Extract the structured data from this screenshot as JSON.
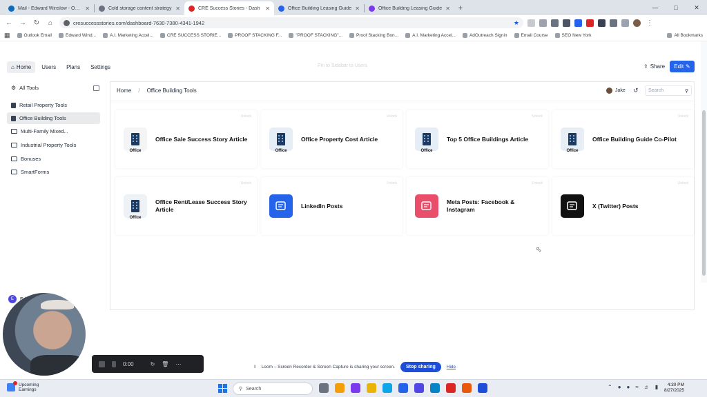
{
  "browser": {
    "tabs": [
      {
        "title": "Mail - Edward Winslow - Outlo",
        "color": "#0f6cbd",
        "active": false
      },
      {
        "title": "Cold storage content strategy",
        "color": "#6b7280",
        "active": false
      },
      {
        "title": "CRE Success Stories - Dash",
        "color": "#dc2626",
        "active": true
      },
      {
        "title": "Office Building Leasing Guide",
        "color": "#2563eb",
        "active": false
      },
      {
        "title": "Office Building Leasing Guide",
        "color": "#7c3aed",
        "active": false
      }
    ],
    "url": "cresuccessstories.com/dashboard-7630-7380-4341-1942",
    "bookmarks": [
      "Outlook Email",
      "Edward Wind...",
      "A.I. Marketing Accel...",
      "CRE SUCCESS STORIE...",
      "PROOF STACKING F...",
      "\"PROOF STACKING\"...",
      "Proof Stacking Bon...",
      "A.I. Marketing Accel...",
      "AdOutreach Signin",
      "Email Course",
      "SEO New York"
    ],
    "all_bookmarks": "All Bookmarks"
  },
  "header": {
    "nav": [
      {
        "label": "Home",
        "active": true
      },
      {
        "label": "Users",
        "active": false
      },
      {
        "label": "Plans",
        "active": false
      },
      {
        "label": "Settings",
        "active": false
      }
    ],
    "center_text": "Pin to Sidebar to Users",
    "share_label": "Share",
    "edit_label": "Edit"
  },
  "sidebar": {
    "all_tools_label": "All Tools",
    "items": [
      {
        "label": "Retail Property Tools",
        "icon": "building-icon",
        "active": false
      },
      {
        "label": "Office Building Tools",
        "icon": "building-icon",
        "active": true
      },
      {
        "label": "Multi-Family Mixed...",
        "icon": "folder-icon",
        "active": false
      },
      {
        "label": "Industrial Property Tools",
        "icon": "folder-icon",
        "active": false
      },
      {
        "label": "Bonuses",
        "icon": "folder-icon",
        "active": false
      },
      {
        "label": "SmartForms",
        "icon": "folder-icon",
        "active": false
      }
    ],
    "profile_name": "Ed...w"
  },
  "main": {
    "breadcrumb": [
      "Home",
      "Office Building Tools"
    ],
    "user_name": "Jake",
    "search_placeholder": "Search",
    "badge_text": "Unlock",
    "cards": [
      {
        "title": "Office Sale Success Story Article",
        "tag": "Office",
        "tile_color": "#f3f4f6",
        "icon": "handshake-icon"
      },
      {
        "title": "Office Property Cost Article",
        "tag": "Office",
        "tile_color": "#e5edf7",
        "icon": "building-icon"
      },
      {
        "title": "Top 5 Office Buildings Article",
        "tag": "Office",
        "tile_color": "#e5edf7",
        "icon": "building-five-icon"
      },
      {
        "title": "Office Building Guide Co-Pilot",
        "tag": "Office",
        "tile_color": "#e8eef5",
        "icon": "pen-icon"
      },
      {
        "title": "Office Rent/Lease Success Story Article",
        "tag": "Office",
        "tile_color": "#eef2f7",
        "icon": "checklist-icon"
      },
      {
        "title": "LinkedIn Posts",
        "tag": "",
        "tile_color": "#2563eb",
        "icon": "post-icon"
      },
      {
        "title": "Meta Posts: Facebook & Instagram",
        "tag": "",
        "tile_color": "#e94f6a",
        "icon": "post-icon"
      },
      {
        "title": "X (Twitter) Posts",
        "tag": "",
        "tile_color": "#111111",
        "icon": "post-icon"
      }
    ]
  },
  "recorder": {
    "time": "0:00"
  },
  "loom": {
    "message": "Loom – Screen Recorder & Screen Capture is sharing your screen.",
    "stop_label": "Stop sharing",
    "hide_label": "Hide"
  },
  "taskbar": {
    "weather_line1": "Upcoming",
    "weather_line2": "Earnings",
    "search_placeholder": "Search",
    "time": "4:30 PM",
    "date": "8/27/2025"
  }
}
